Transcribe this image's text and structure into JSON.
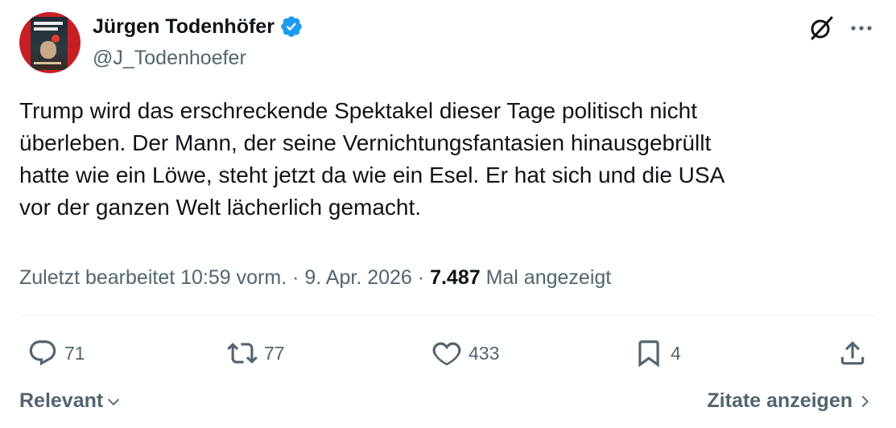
{
  "author": {
    "name": "Jürgen Todenhöfer",
    "handle": "@J_Todenhoefer",
    "verified": true
  },
  "tweet": {
    "text": "Trump wird das erschreckende Spektakel dieser Tage politisch nicht\nüberleben. Der Mann, der seine Vernichtungsfantasien hinausgebrüllt\nhatte wie ein Löwe, steht jetzt da wie ein Esel. Er hat sich und die USA\nvor der ganzen Welt lächerlich gemacht."
  },
  "meta": {
    "edited_label": "Zuletzt bearbeitet",
    "time": "10:59 vorm.",
    "separator": "·",
    "date": "9. Apr. 2026",
    "views": "7.487",
    "views_label": "Mal angezeigt"
  },
  "actions": {
    "replies": "71",
    "reposts": "77",
    "likes": "433",
    "bookmarks": "4"
  },
  "footer": {
    "sort_label": "Relevant",
    "quotes_label": "Zitate anzeigen"
  },
  "colors": {
    "text_primary": "#0f1419",
    "text_secondary": "#536471",
    "verified_blue": "#1d9bf0",
    "divider": "#eff3f4"
  },
  "icons": {
    "verified": "verified-badge-icon",
    "grok": "grok-icon",
    "more": "more-icon",
    "reply": "reply-icon",
    "repost": "repost-icon",
    "like": "heart-icon",
    "bookmark": "bookmark-icon",
    "share": "share-icon"
  }
}
